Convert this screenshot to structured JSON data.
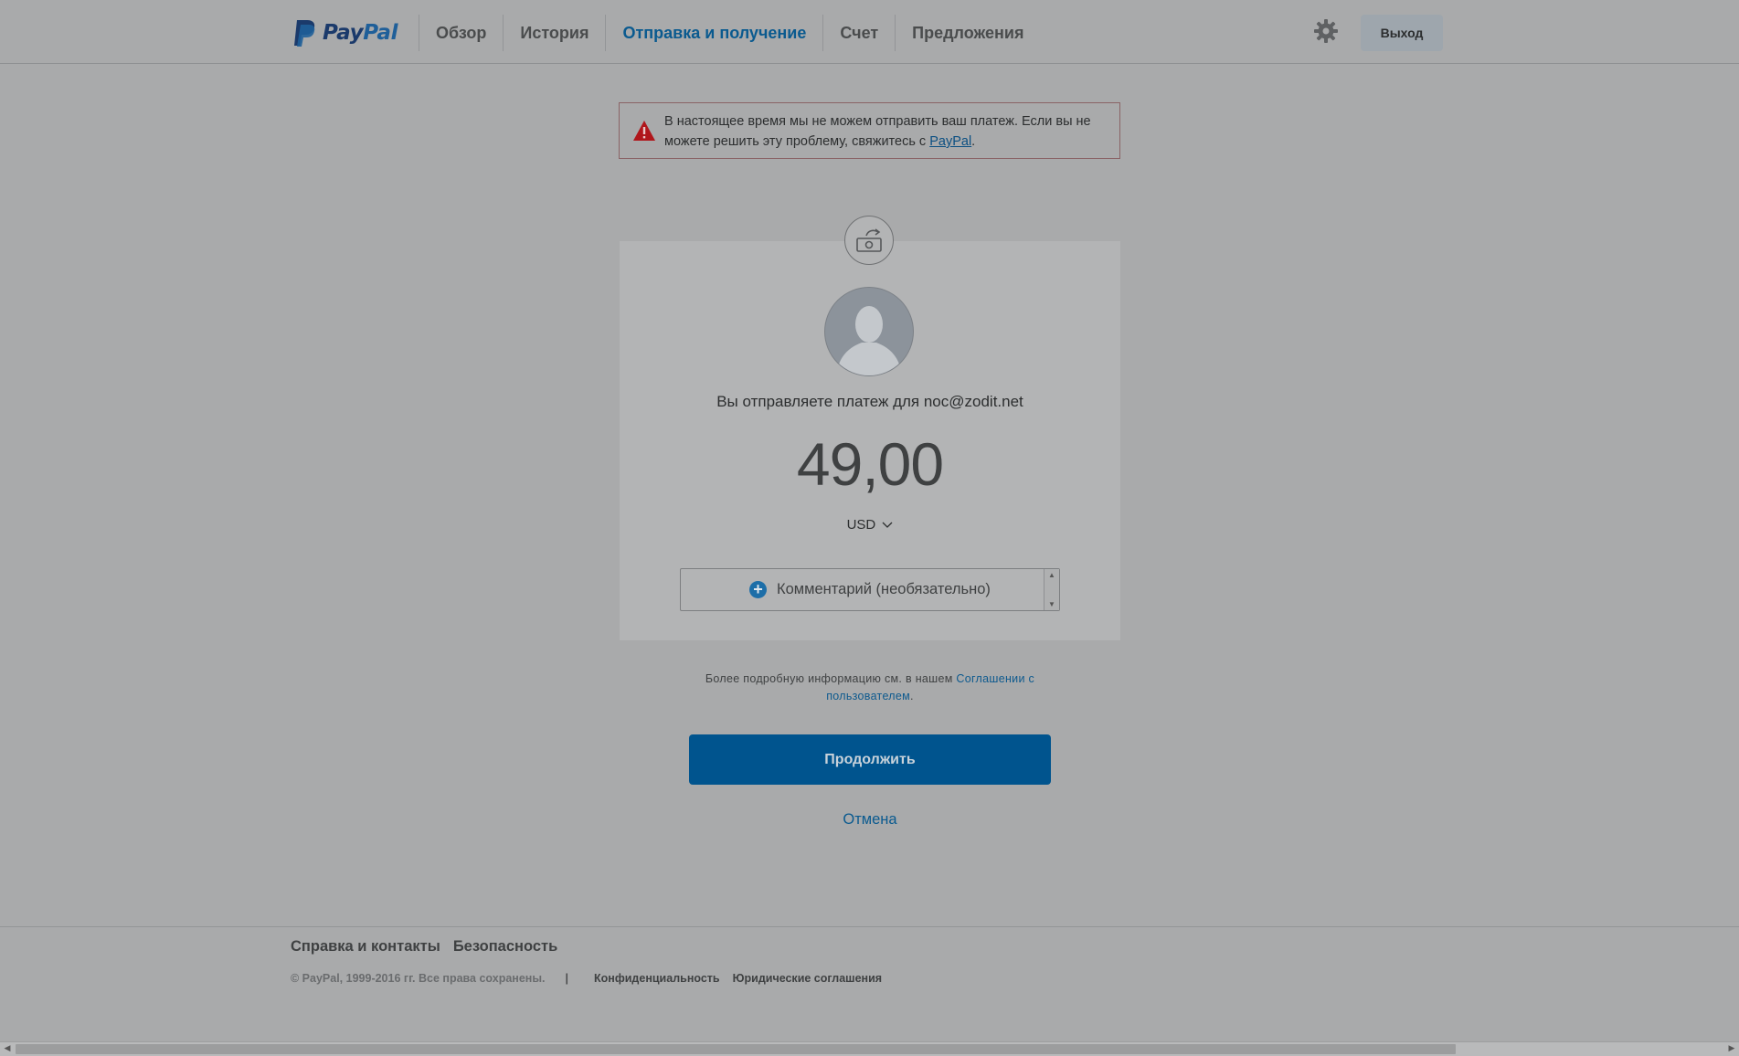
{
  "header": {
    "logo_pay": "Pay",
    "logo_pal": "Pal",
    "nav": [
      {
        "label": "Обзор"
      },
      {
        "label": "История"
      },
      {
        "label": "Отправка и получение"
      },
      {
        "label": "Счет"
      },
      {
        "label": "Предложения"
      }
    ],
    "active_nav": "Отправка и получение",
    "logout_label": "Выход",
    "settings_icon": "gear-icon"
  },
  "alert": {
    "text": "В настоящее время мы не можем отправить ваш платеж. Если вы не можете решить эту проблему, свяжитесь с ",
    "link": "PayPal",
    "trailing": ".",
    "icon": "warning-icon"
  },
  "payment": {
    "recipient_text": "Вы отправляете платеж для noc@zodit.net",
    "amount": "49,00",
    "currency": "USD",
    "comment_placeholder": "Комментарий (необязательно)",
    "agreement_text": "Более подробную информацию см. в нашем ",
    "agreement_link": "Соглашении с пользователем",
    "agreement_end": ".",
    "continue_label": "Продолжить",
    "cancel_label": "Отмена"
  },
  "footer": {
    "links": [
      "Справка и контакты",
      "Безопасность"
    ],
    "copyright": "© PayPal, 1999-2016 гг. Все права сохранены.",
    "separator": "|",
    "legal_links": [
      "Конфиденциальность",
      "Юридические соглашения"
    ]
  },
  "colors": {
    "accent": "#0a5a8f",
    "button": "#00548e",
    "alert_red": "#b0161b"
  }
}
